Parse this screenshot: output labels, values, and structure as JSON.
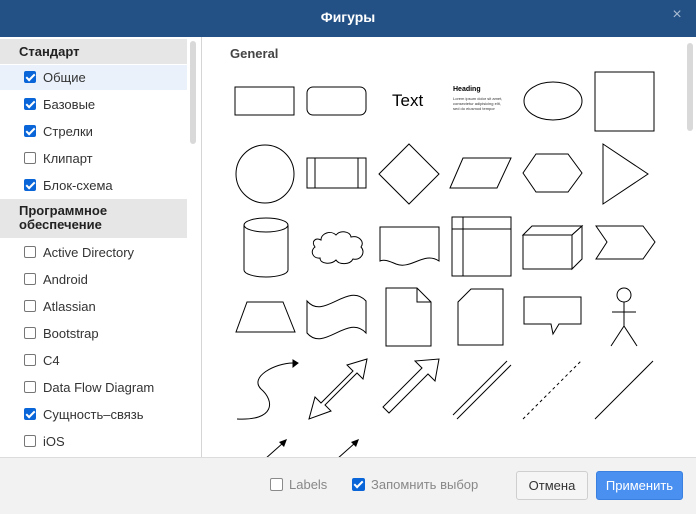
{
  "dialog": {
    "title": "Фигуры",
    "close_icon": "×"
  },
  "sidebar": {
    "groups": [
      {
        "title": "Стандарт",
        "items": [
          {
            "label": "Общие",
            "checked": true,
            "active": true
          },
          {
            "label": "Базовые",
            "checked": true
          },
          {
            "label": "Стрелки",
            "checked": true
          },
          {
            "label": "Клипарт",
            "checked": false
          },
          {
            "label": "Блок-схема",
            "checked": true
          }
        ]
      },
      {
        "title": "Программное обеспечение",
        "items": [
          {
            "label": "Active Directory",
            "checked": false
          },
          {
            "label": "Android",
            "checked": false
          },
          {
            "label": "Atlassian",
            "checked": false
          },
          {
            "label": "Bootstrap",
            "checked": false
          },
          {
            "label": "C4",
            "checked": false
          },
          {
            "label": "Data Flow Diagram",
            "checked": false
          },
          {
            "label": "Сущность–связь",
            "checked": true
          },
          {
            "label": "iOS",
            "checked": false
          }
        ]
      }
    ]
  },
  "preview": {
    "section_title": "General",
    "text_shape_label": "Text",
    "textbox_heading": "Heading",
    "textbox_body": "Lorem ipsum dolor sit amet, consectetur adipisicing elit, sed do eiusmod tempor incididunt ut labore et dolore magna aliqua."
  },
  "footer": {
    "labels_option": {
      "label": "Labels",
      "checked": false
    },
    "remember_option": {
      "label": "Запомнить выбор",
      "checked": true
    },
    "cancel_label": "Отмена",
    "apply_label": "Применить"
  }
}
